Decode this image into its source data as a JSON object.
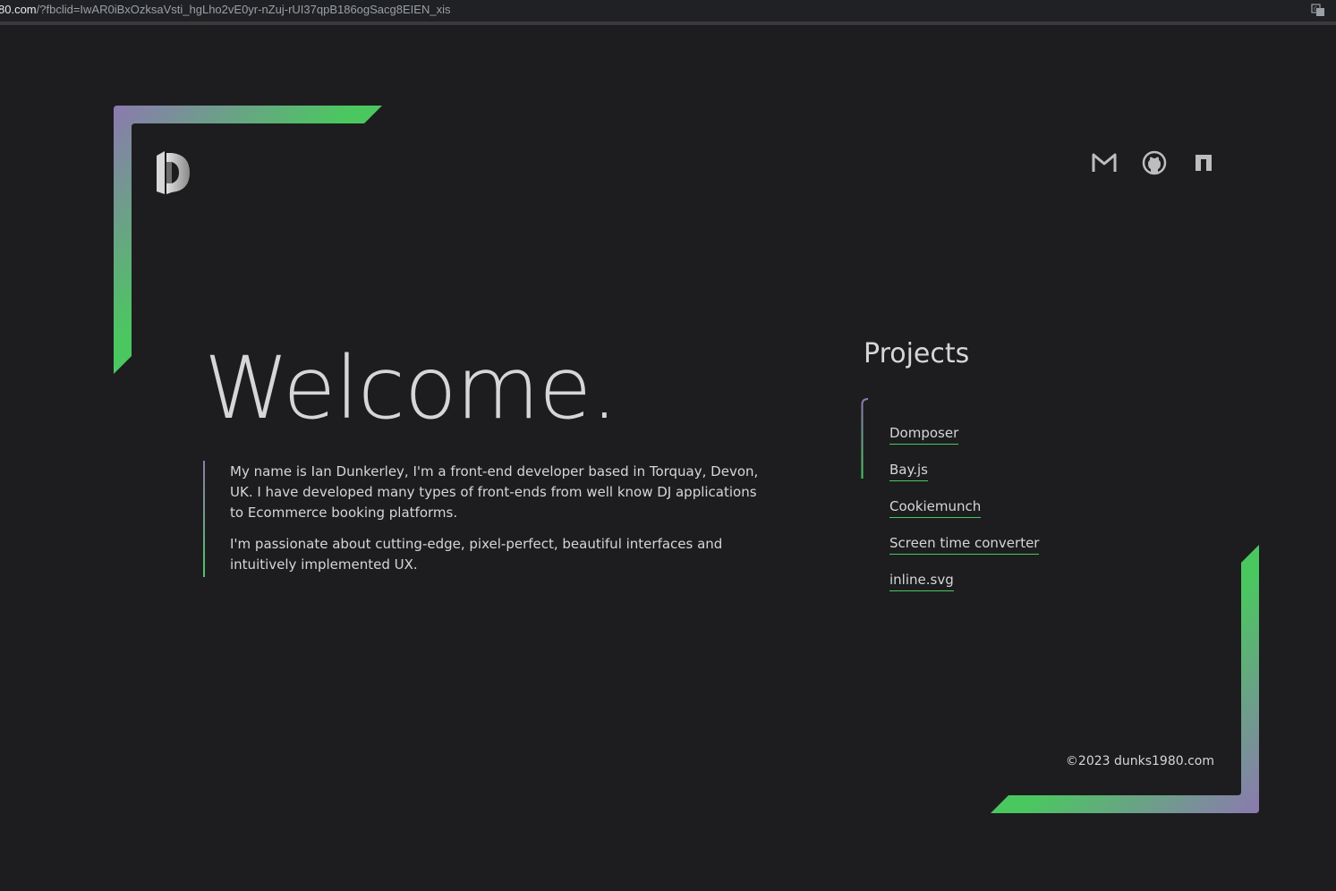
{
  "browser": {
    "url_host": "80.com",
    "url_path": "/?fbclid=IwAR0iBxOzksaVsti_hgLho2vE0yr-nZuj-rUI37qpB186ogSacg8EIEN_xis"
  },
  "header": {
    "logo": "logo-icon",
    "social": [
      {
        "icon": "gmail-icon"
      },
      {
        "icon": "github-icon"
      },
      {
        "icon": "npm-icon"
      }
    ]
  },
  "hero": {
    "title": "Welcome.",
    "paragraphs": [
      "My name is Ian Dunkerley, I'm a front-end developer based in Torquay, Devon, UK. I have developed many types of front-ends from well know DJ applications to Ecommerce booking platforms.",
      "I'm passionate about cutting-edge, pixel-perfect, beautiful interfaces and intuitively implemented UX."
    ]
  },
  "projects": {
    "title": "Projects",
    "items": [
      {
        "label": "Domposer"
      },
      {
        "label": "Bay.js"
      },
      {
        "label": "Cookiemunch"
      },
      {
        "label": "Screen time converter"
      },
      {
        "label": "inline.svg"
      }
    ]
  },
  "footer": {
    "copyright": "©2023 dunks1980.com"
  },
  "colors": {
    "background": "#1d1d20",
    "accent_green": "#4bc760",
    "accent_purple": "#8c79b0",
    "text": "#d6d6d6"
  }
}
